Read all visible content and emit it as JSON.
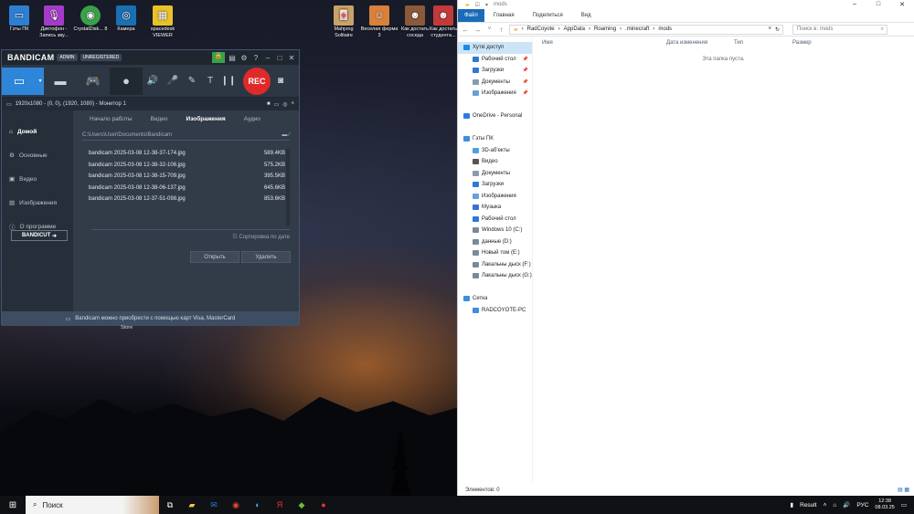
{
  "desktop": {
    "icons": [
      {
        "label": "Гэты ПК",
        "icon": "pc-icon"
      },
      {
        "label": "Диктофон - Запись зву...",
        "icon": "mic-icon"
      },
      {
        "label": "CrystalDisk... 8",
        "icon": "disk-icon"
      },
      {
        "label": "Камера",
        "icon": "camera-icon"
      },
      {
        "label": "spacedesk VIEWER",
        "icon": "spacedesk-icon"
      },
      {
        "label": "Mahjong Solitaire",
        "icon": "mahjong-icon"
      },
      {
        "label": "Веселая ферма 3",
        "icon": "farm-icon"
      },
      {
        "label": "Как достать соседа",
        "icon": "neighbor-icon"
      },
      {
        "label": "Как достать студента...",
        "icon": "student-icon"
      }
    ]
  },
  "bandicam": {
    "logo": "BANDICAM",
    "admin": "ADMIN",
    "unregistered": "UNREGISTERED",
    "rec": "REC",
    "target": "1920x1080 - (0, 0), (1920, 1080) - Монитор 1",
    "side": [
      "Домой",
      "Основные",
      "Видео",
      "Изображения",
      "О программе"
    ],
    "tabs": [
      "Начало работы",
      "Видео",
      "Изображения",
      "Аудио"
    ],
    "path": "C:\\Users\\User\\Documents\\Bandicam",
    "files": [
      {
        "name": "bandicam 2025-03-08 12-38-37-174.jpg",
        "size": "589.4KB"
      },
      {
        "name": "bandicam 2025-03-08 12-38-32-106.jpg",
        "size": "575.2KB"
      },
      {
        "name": "bandicam 2025-03-08 12-38-15-709.jpg",
        "size": "395.5KB"
      },
      {
        "name": "bandicam 2025-03-08 12-38-06-137.jpg",
        "size": "645.6KB"
      },
      {
        "name": "bandicam 2025-03-08 12-37-51-098.jpg",
        "size": "853.6KB"
      }
    ],
    "sort": "Сортировка по дате",
    "open": "Открыть",
    "delete": "Удалить",
    "bandicut": "BANDICUT",
    "footer": "Bandicam можно приобрести с помощью карт Visa, MasterCard",
    "desk_caption": "Store"
  },
  "explorer": {
    "title": "mods",
    "ribbon": [
      "Файл",
      "Главная",
      "Поделиться",
      "Вид"
    ],
    "address": [
      "RadCoyote",
      "AppData",
      "Roaming",
      ".minecraft",
      "mods"
    ],
    "search_placeholder": "Поиск в: mods",
    "columns": [
      "Имя",
      "Дата изменения",
      "Тип",
      "Размер"
    ],
    "empty": "Эта папка пуста.",
    "status": "Элементов: 0",
    "nav": [
      {
        "label": "Хуткі доступ",
        "color": "#1e88e5",
        "sel": true
      },
      {
        "label": "Рабочий стол",
        "color": "#2b7bd6",
        "pin": true
      },
      {
        "label": "Загрузки",
        "color": "#2b7bd6",
        "pin": true
      },
      {
        "label": "Документы",
        "color": "#8a9bb0",
        "pin": true
      },
      {
        "label": "Изображения",
        "color": "#6aa0d8",
        "pin": true
      },
      {
        "label": "",
        "color": ""
      },
      {
        "label": "OneDrive - Personal",
        "color": "#2a7de1"
      },
      {
        "label": "",
        "color": ""
      },
      {
        "label": "Гэты ПК",
        "color": "#3b8ee0"
      },
      {
        "label": "3D-аб'екты",
        "color": "#4aa3df"
      },
      {
        "label": "Видео",
        "color": "#555"
      },
      {
        "label": "Документы",
        "color": "#8a9bb0"
      },
      {
        "label": "Загрузки",
        "color": "#2b7bd6"
      },
      {
        "label": "Изображения",
        "color": "#6aa0d8"
      },
      {
        "label": "Музыка",
        "color": "#3b6fd6"
      },
      {
        "label": "Рабочий стол",
        "color": "#2b7bd6"
      },
      {
        "label": "Windows 10 (C:)",
        "color": "#7a8a9a"
      },
      {
        "label": "данные (D:)",
        "color": "#7a8a9a"
      },
      {
        "label": "Новый том (E:)",
        "color": "#7a8a9a"
      },
      {
        "label": "Лакальны дыск (F:)",
        "color": "#7a8a9a"
      },
      {
        "label": "Лакальны дыск (G:)",
        "color": "#7a8a9a"
      },
      {
        "label": "",
        "color": ""
      },
      {
        "label": "Сетка",
        "color": "#3b8ee0"
      },
      {
        "label": "RADCOYOTE-PC",
        "color": "#3b8ee0"
      }
    ]
  },
  "taskbar": {
    "search": "Поиск",
    "result": "Result",
    "lang": "РУС",
    "time": "12:38",
    "date": "08.03.25"
  }
}
